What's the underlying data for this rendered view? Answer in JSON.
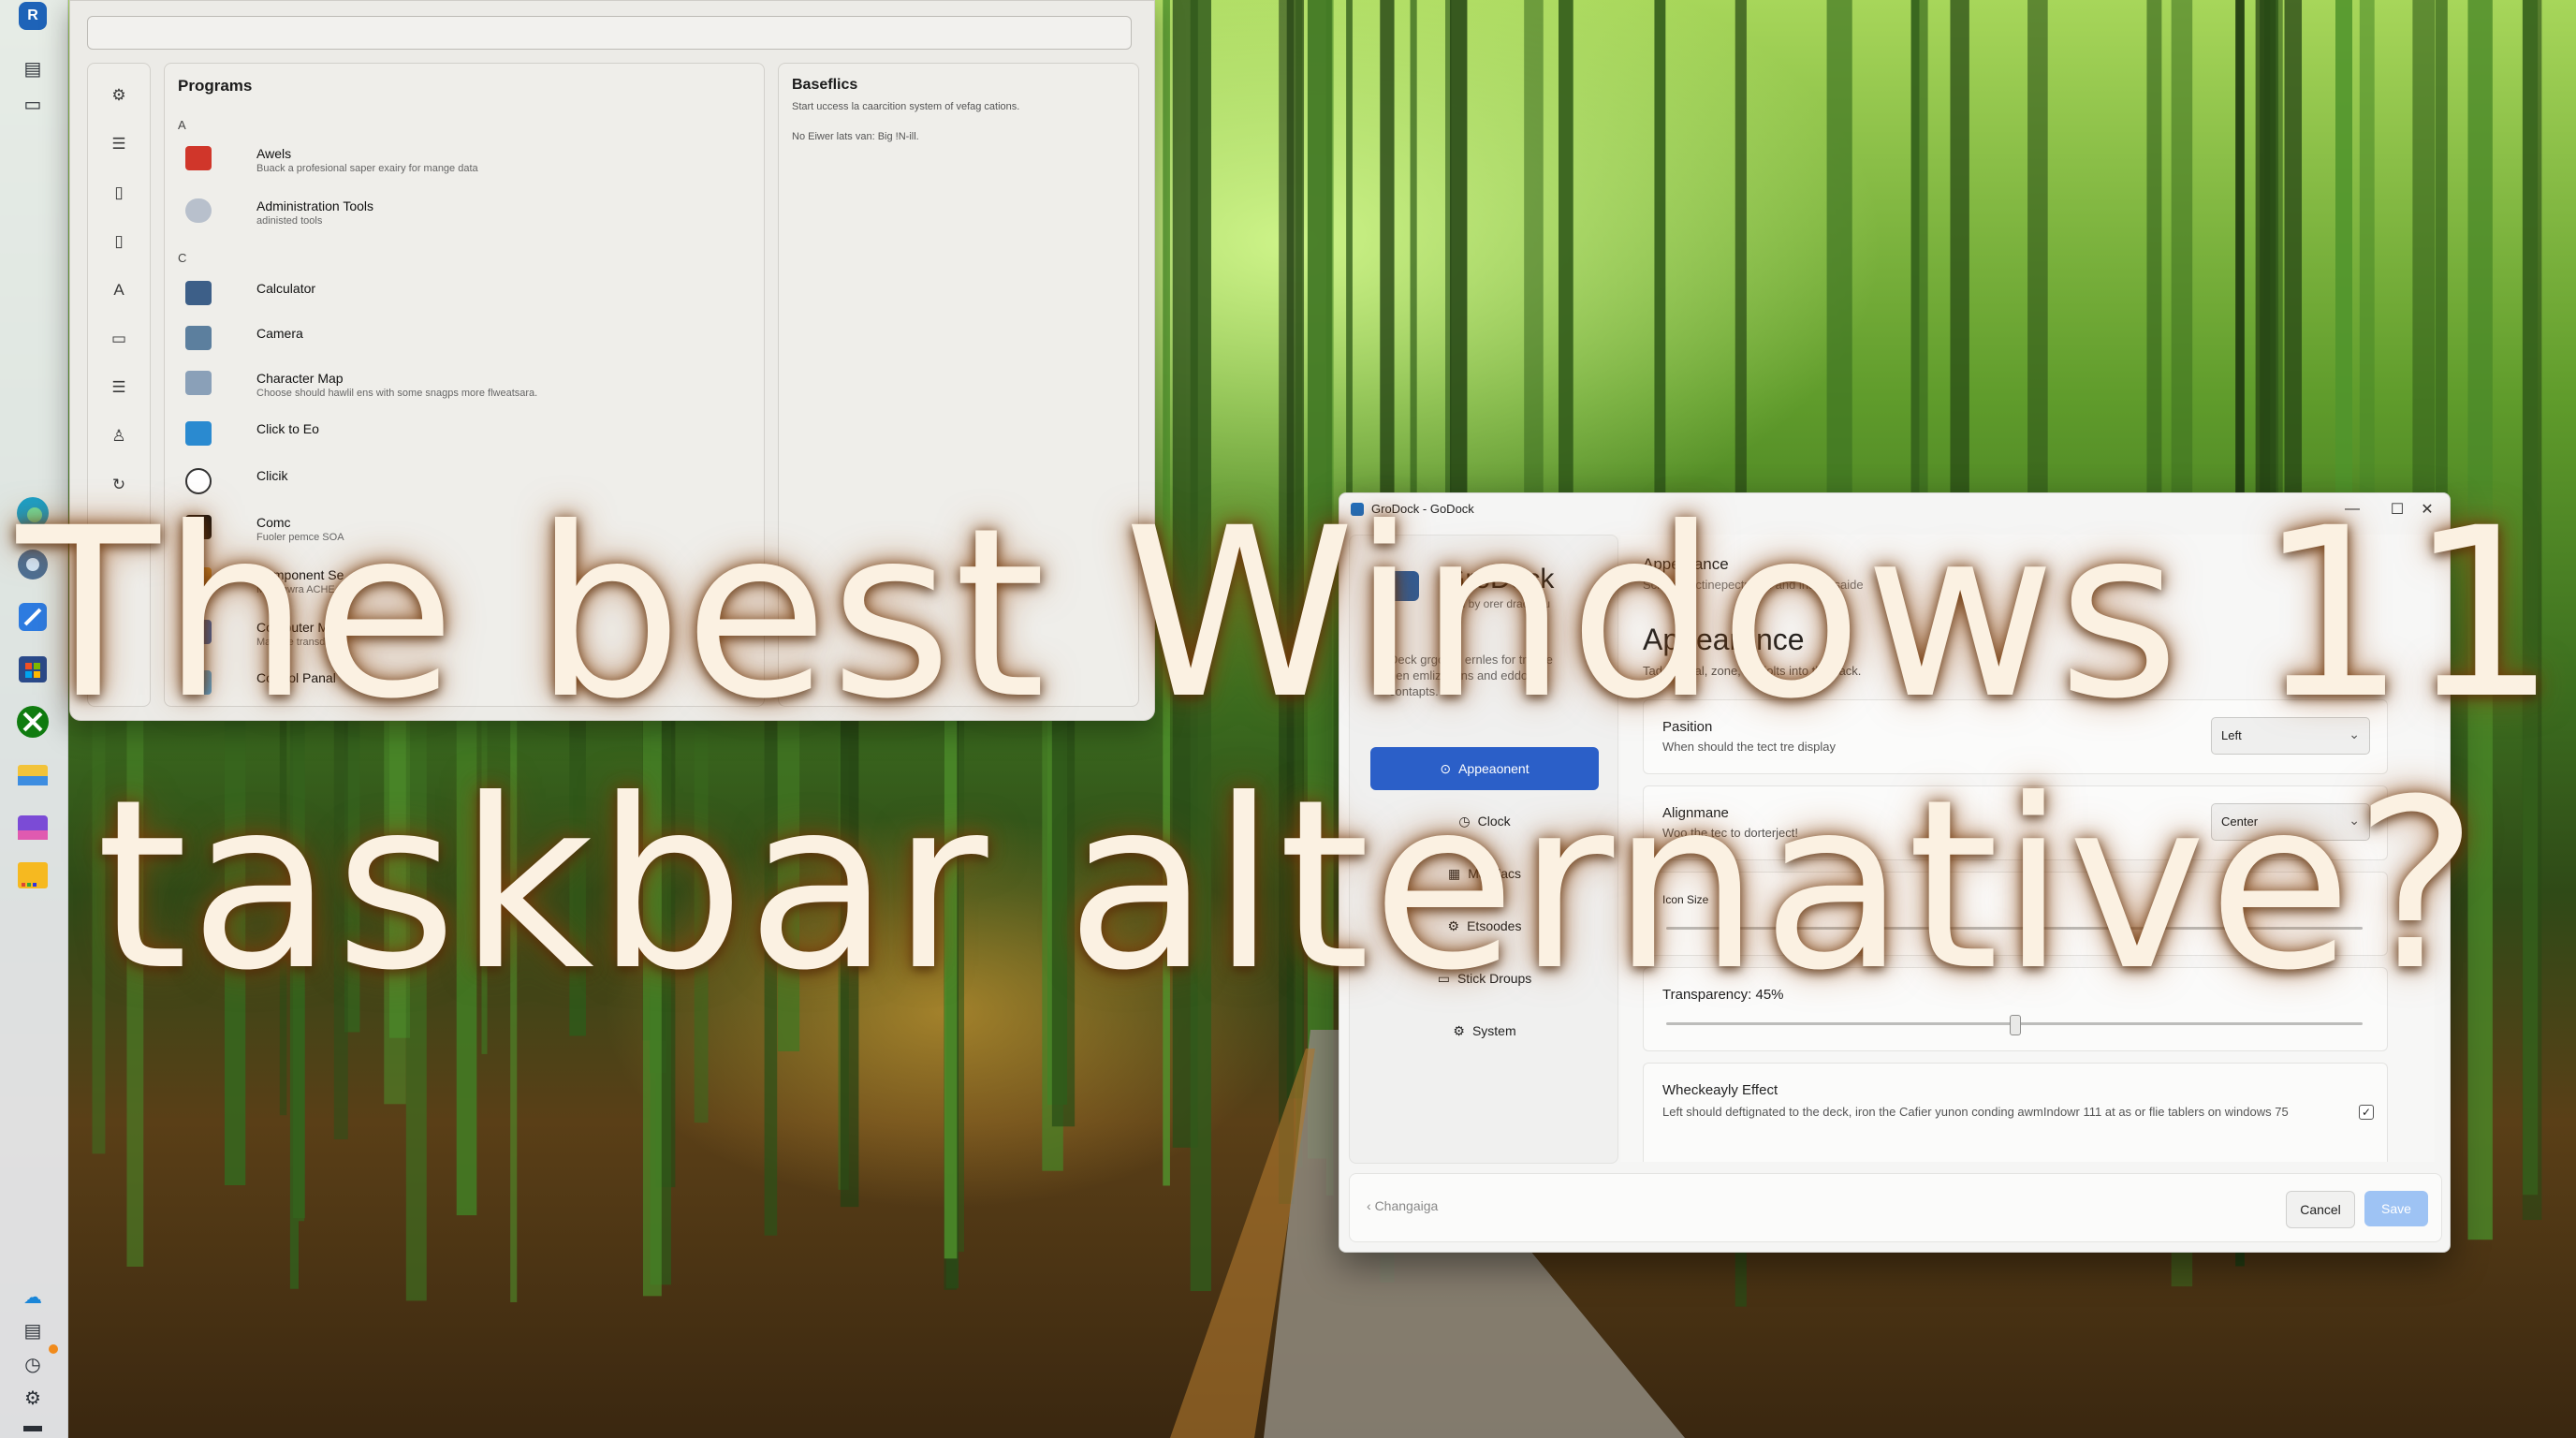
{
  "programs_window": {
    "list_title": "Programs",
    "sections": [
      {
        "letter": "A",
        "items": [
          {
            "name": "Awels",
            "desc": "Buack a profesional saper exairy for mange data",
            "icon": "office-red-icon"
          },
          {
            "name": "Administration Tools",
            "desc": "adinisted tools",
            "icon": "admin-tools-icon"
          }
        ]
      },
      {
        "letter": "C",
        "items": [
          {
            "name": "Calculator",
            "desc": "",
            "icon": "calculator-icon"
          },
          {
            "name": "Camera",
            "desc": "",
            "icon": "camera-icon"
          },
          {
            "name": "Character Map",
            "desc": "Choose should hawlil ens with some snagps more flweatsara.",
            "icon": "character-map-icon"
          },
          {
            "name": "Click to Eo",
            "desc": "",
            "icon": "click-to-do-icon"
          },
          {
            "name": "Clicik",
            "desc": "",
            "icon": "clock-icon"
          },
          {
            "name": "Comc",
            "desc": "Fuoler pemce SOA",
            "icon": "terminal-icon"
          },
          {
            "name": "Component Se",
            "desc": "Mevogwra ACHE",
            "icon": "component-services-icon"
          },
          {
            "name": "Computer Ma",
            "desc": "Manage transd",
            "icon": "computer-management-icon"
          },
          {
            "name": "Control Panal",
            "desc": "",
            "icon": "control-panel-icon"
          }
        ]
      }
    ],
    "detail": {
      "title": "Baseflics",
      "text1": "Start uccess la caarcition system of vefag cations.",
      "text2": "No Eiwer lats van: Big !N-ill."
    }
  },
  "settings_window": {
    "title": "GroDock - GoDock",
    "app_name": "GroDock",
    "app_tagline": "mod by orer drao you",
    "nav_description": "Deck grgomo ernles for trasire hen emlizations and eddor contapts.",
    "nav_items": [
      {
        "label": "Appeaonent",
        "icon": "appearance-icon",
        "active": true
      },
      {
        "label": "Clock",
        "icon": "clock-icon",
        "active": false
      },
      {
        "label": "Mandacs",
        "icon": "modules-icon",
        "active": false
      },
      {
        "label": "Etsoodes",
        "icon": "extras-icon",
        "active": false
      },
      {
        "label": "Stick Droups",
        "icon": "stick-groups-icon",
        "active": false
      },
      {
        "label": "System",
        "icon": "system-gear-icon",
        "active": false
      }
    ],
    "section_top": "Appearance",
    "section_top_desc": "Sclid a sectinepectre on and insido saide",
    "heading": "Appearance",
    "heading_desc": "Tade typzal, zone, ceniolts into the dack.",
    "cards": {
      "position": {
        "title": "Pasition",
        "desc": "When should the tect tre display",
        "value": "Left"
      },
      "alignment": {
        "title": "Alignmane",
        "desc": "Woo the tec to dorterject!",
        "value": "Center"
      },
      "size": {
        "title": "Icon Size",
        "level_percent": 70
      },
      "transparency": {
        "title": "Transparency: 45%",
        "level_percent": 50
      },
      "effect": {
        "title": "Wheckeayly Effect",
        "desc": "Left should deftignated to the deck, iron the Cafier yunon conding awmIndowr 111 at as or flie tablers on windows 75",
        "checked": true
      }
    },
    "footer": {
      "breadcrumb": "Changaiga",
      "cancel": "Cancel",
      "save": "Save"
    },
    "controls": {
      "minimize": "—",
      "maximize": "☐",
      "close": "✕"
    }
  },
  "headline": {
    "line1": "The best Windows 11",
    "line2": "taskbar alternative?"
  },
  "taskbar": {
    "icons": [
      "app-logo-icon",
      "widgets-icon",
      "file-explorer-icon",
      "edge-icon",
      "settings-icon",
      "copilot-icon",
      "store-icon",
      "xbox-icon",
      "folder-icon",
      "teams-icon",
      "sticky-notes-icon",
      "onedrive-icon",
      "notepad-icon",
      "history-icon",
      "control-icon",
      "menu-icon"
    ]
  },
  "colors": {
    "accent": "#2b5fc8",
    "save_disabled": "#9ec3f4",
    "headline": "#fbf1e2"
  }
}
